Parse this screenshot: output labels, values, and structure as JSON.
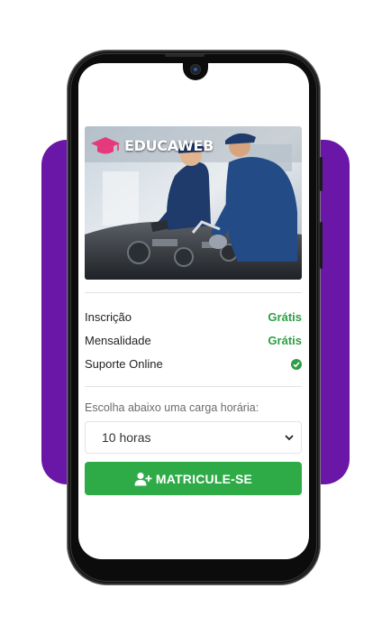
{
  "brand": {
    "name": "EDUCAWEB"
  },
  "colors": {
    "purple_accent": "#6a17a8",
    "success_green": "#2f9e44",
    "button_green": "#2eab47"
  },
  "course_image": {
    "alt": "mechanics working under car hood"
  },
  "details": [
    {
      "label": "Inscrição",
      "value": "Grátis"
    },
    {
      "label": "Mensalidade",
      "value": "Grátis"
    },
    {
      "label": "Suporte Online",
      "icon": "check-circle-icon"
    }
  ],
  "workload": {
    "label": "Escolha abaixo uma carga horária:",
    "selected": "10 horas",
    "icon": "chevron-down-icon"
  },
  "enroll_button": {
    "label": "MATRICULE-SE",
    "icon": "user-plus-icon"
  }
}
